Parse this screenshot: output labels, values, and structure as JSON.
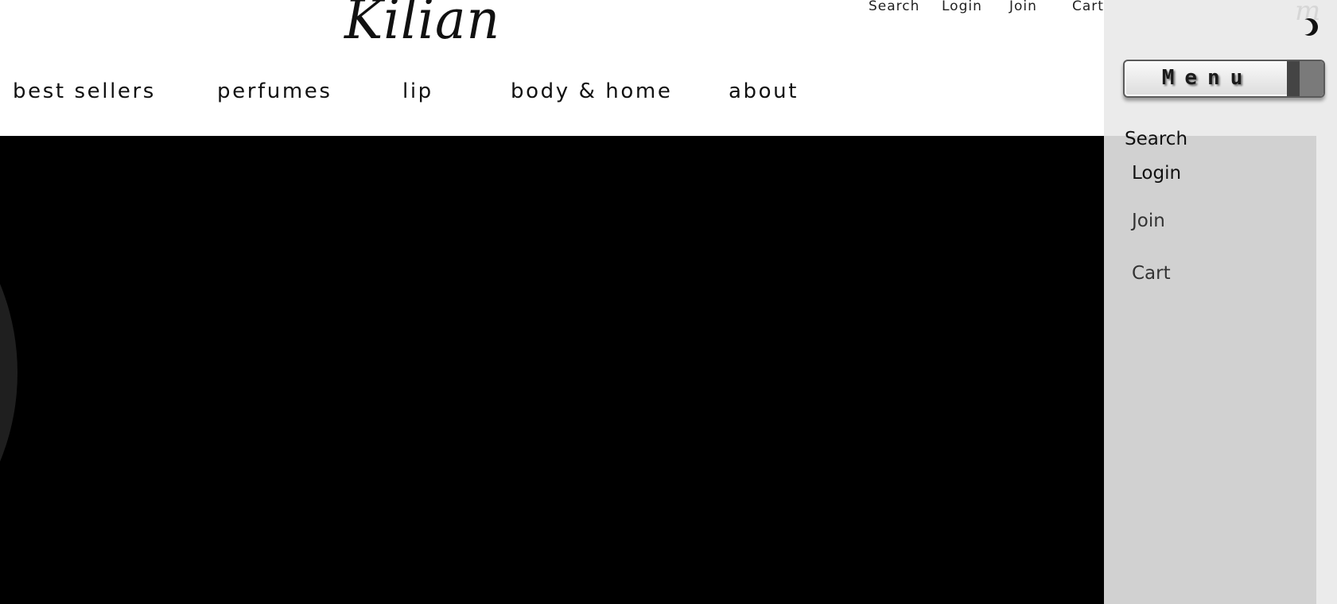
{
  "header": {
    "logo_text": "Kilian",
    "utility_links": [
      "Search",
      "Login",
      "Join",
      "Cart"
    ]
  },
  "main_nav": {
    "items": [
      "best sellers",
      "perfumes",
      "lip",
      "body & home",
      "about"
    ]
  },
  "side_panel": {
    "corner_glyph": "m",
    "menu_label": "Menu",
    "links": [
      "Search",
      "Login",
      "Join",
      "Cart"
    ]
  },
  "colors": {
    "hero_background": "#000000",
    "panel_background": "#ebebeb",
    "panel_list_background": "#d1d1d1"
  },
  "icons": {
    "panel_toggle": "close-crescent-icon"
  }
}
